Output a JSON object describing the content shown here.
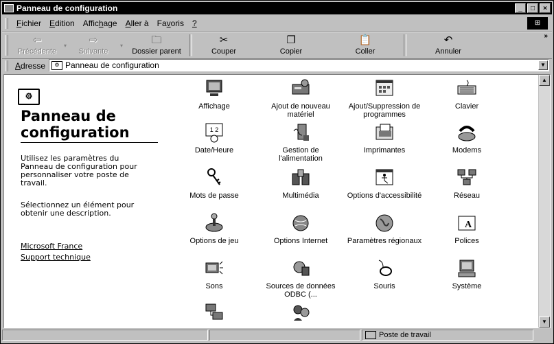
{
  "window": {
    "title": "Panneau de configuration"
  },
  "menu": [
    {
      "label": "Fichier",
      "u": "F",
      "rest": "ichier"
    },
    {
      "label": "Edition",
      "u": "E",
      "rest": "dition"
    },
    {
      "label": "Affichage",
      "pre": "Affic",
      "u": "h",
      "post": "age"
    },
    {
      "label": "Aller à",
      "u": "A",
      "rest": "ller à"
    },
    {
      "label": "Favoris",
      "pre": "Fa",
      "u": "v",
      "post": "oris"
    },
    {
      "label": "?",
      "u": "?",
      "rest": ""
    }
  ],
  "toolbar": {
    "back": "Précédente",
    "forward": "Suivante",
    "up": "Dossier parent",
    "cut": "Couper",
    "copy": "Copier",
    "paste": "Coller",
    "undo": "Annuler"
  },
  "address": {
    "label": "Adresse",
    "value": "Panneau de configuration"
  },
  "left": {
    "title_line1": "Panneau de",
    "title_line2": "configuration",
    "description": "Utilisez les paramètres du Panneau de configuration pour personnaliser votre poste de travail.",
    "hint": "Sélectionnez un élément pour obtenir une description.",
    "link1": "Microsoft France",
    "link2": "Support technique"
  },
  "items": [
    {
      "label": "Affichage",
      "icon": "display-icon"
    },
    {
      "label": "Ajout de nouveau matériel",
      "icon": "add-hardware-icon"
    },
    {
      "label": "Ajout/Suppression de programmes",
      "icon": "add-remove-programs-icon"
    },
    {
      "label": "Clavier",
      "icon": "keyboard-icon"
    },
    {
      "label": "Date/Heure",
      "icon": "calendar-clock-icon"
    },
    {
      "label": "Gestion de l'alimentation",
      "icon": "power-management-icon"
    },
    {
      "label": "Imprimantes",
      "icon": "printers-folder-icon"
    },
    {
      "label": "Modems",
      "icon": "modem-telephone-icon"
    },
    {
      "label": "Mots de passe",
      "icon": "keys-icon"
    },
    {
      "label": "Multimédia",
      "icon": "multimedia-icon"
    },
    {
      "label": "Options d'accessibilité",
      "icon": "accessibility-icon"
    },
    {
      "label": "Réseau",
      "icon": "network-icon"
    },
    {
      "label": "Options de jeu",
      "icon": "joystick-icon"
    },
    {
      "label": "Options Internet",
      "icon": "internet-options-icon"
    },
    {
      "label": "Paramètres régionaux",
      "icon": "globe-icon"
    },
    {
      "label": "Polices",
      "icon": "fonts-folder-icon"
    },
    {
      "label": "Sons",
      "icon": "speaker-computer-icon"
    },
    {
      "label": "Sources de données ODBC (...",
      "icon": "odbc-icon"
    },
    {
      "label": "Souris",
      "icon": "mouse-icon"
    },
    {
      "label": "Système",
      "icon": "computer-icon"
    },
    {
      "label": "",
      "icon": "computers-icon"
    },
    {
      "label": "",
      "icon": "users-icon"
    }
  ],
  "status": {
    "location": "Poste de travail"
  }
}
